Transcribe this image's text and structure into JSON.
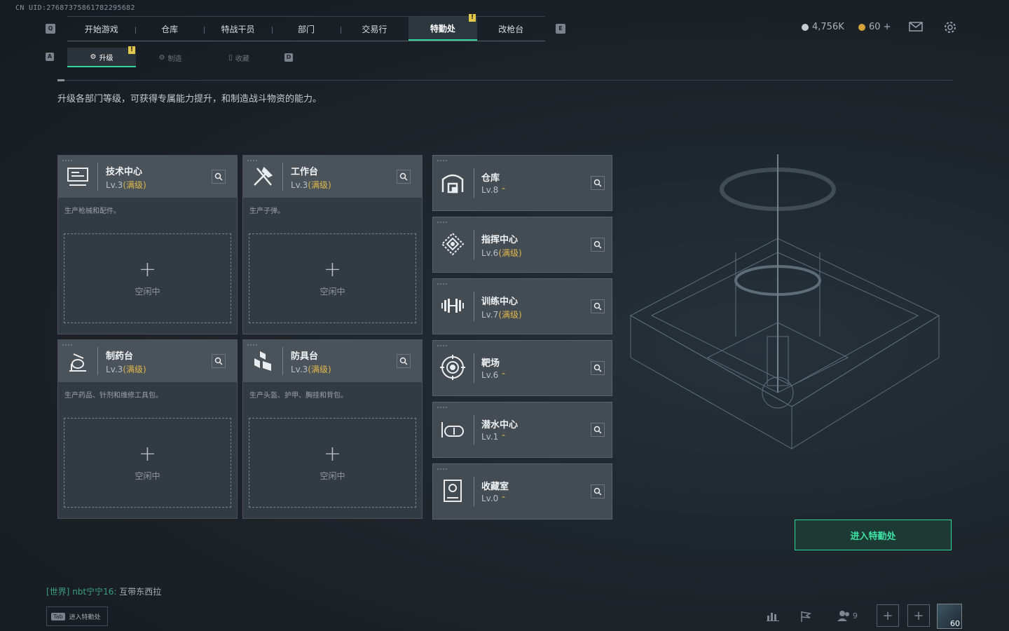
{
  "uid": "CN UID:27687375861782295682",
  "nav": {
    "tabs": [
      "开始游戏",
      "仓库",
      "特战干员",
      "部门",
      "交易行",
      "特勤处",
      "改枪台"
    ],
    "active": "特勤处",
    "key_left": "Q",
    "key_right": "E"
  },
  "currency": {
    "coins": "4,756K",
    "tokens": "60 +"
  },
  "subnav": {
    "tabs": [
      "升级",
      "制造",
      "收藏"
    ],
    "key_left": "A",
    "key_right": "D"
  },
  "description": "升级各部门等级，可获得专属能力提升，和制造战斗物资的能力。",
  "cards": [
    {
      "title": "技术中心",
      "lv": "Lv.3",
      "max": "(满级)",
      "desc": "生产枪械和配件。",
      "plus": "+",
      "idle": "空闲中",
      "icon": "computer-icon"
    },
    {
      "title": "工作台",
      "lv": "Lv.3",
      "max": "(满级)",
      "desc": "生产子弹。",
      "plus": "+",
      "idle": "空闲中",
      "icon": "tools-icon"
    },
    {
      "title": "制药台",
      "lv": "Lv.3",
      "max": "(满级)",
      "desc": "生产药品、针剂和维修工具包。",
      "plus": "+",
      "idle": "空闲中",
      "icon": "flask-icon"
    },
    {
      "title": "防具台",
      "lv": "Lv.3",
      "max": "(满级)",
      "desc": "生产头盔、护甲、胸挂和背包。",
      "plus": "+",
      "idle": "空闲中",
      "icon": "blocks-icon"
    }
  ],
  "departments": [
    {
      "title": "仓库",
      "lv": "Lv.8",
      "max": "",
      "up": "⌃",
      "icon": "warehouse-icon"
    },
    {
      "title": "指挥中心",
      "lv": "Lv.6",
      "max": "(满级)",
      "up": "",
      "icon": "command-icon"
    },
    {
      "title": "训练中心",
      "lv": "Lv.7",
      "max": "(满级)",
      "up": "",
      "icon": "dumbbell-icon"
    },
    {
      "title": "靶场",
      "lv": "Lv.6",
      "max": "",
      "up": "⌃",
      "icon": "target-icon"
    },
    {
      "title": "潜水中心",
      "lv": "Lv.1",
      "max": "",
      "up": "⌃",
      "icon": "goggles-icon"
    },
    {
      "title": "收藏室",
      "lv": "Lv.0",
      "max": "",
      "up": "⌃",
      "icon": "collection-icon"
    }
  ],
  "enter_button": "进入特勤处",
  "chat": {
    "channel": "[世界]",
    "name": "nbt宁宁16:",
    "message": "互带东西拉"
  },
  "tab_hint": {
    "key": "Tab",
    "label": "进入特勤处"
  },
  "bottom": {
    "friends_count": "9",
    "level": "60"
  },
  "colors": {
    "accent": "#2fd79a",
    "max_level": "#e0b84c",
    "badge": "#e2c84a"
  }
}
